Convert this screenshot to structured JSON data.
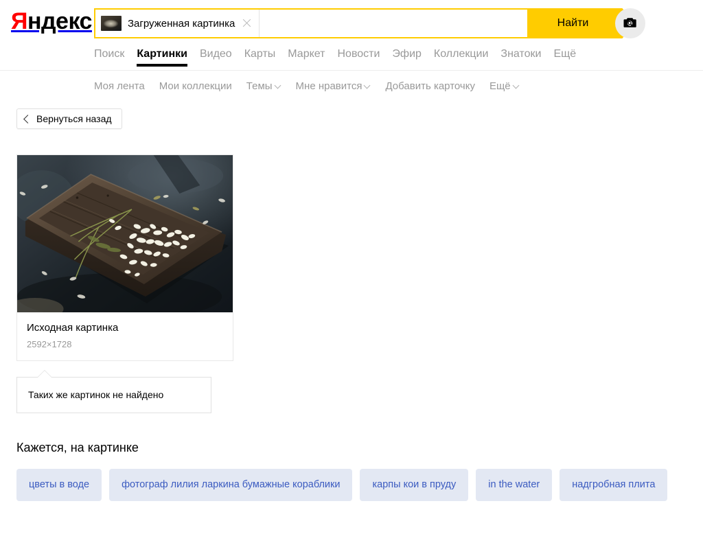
{
  "brand": {
    "logo_first_letter": "Я",
    "logo_rest": "ндекс"
  },
  "search": {
    "chip_label": "Загруженная картинка",
    "chip_thumb_icon": "uploaded-image-thumbnail",
    "chip_close_icon": "close-icon",
    "input_value": "",
    "input_placeholder": "",
    "submit_label": "Найти",
    "camera_icon": "camera-search-icon"
  },
  "nav": {
    "tabs": [
      {
        "label": "Поиск",
        "active": false
      },
      {
        "label": "Картинки",
        "active": true
      },
      {
        "label": "Видео",
        "active": false
      },
      {
        "label": "Карты",
        "active": false
      },
      {
        "label": "Маркет",
        "active": false
      },
      {
        "label": "Новости",
        "active": false
      },
      {
        "label": "Эфир",
        "active": false
      },
      {
        "label": "Коллекции",
        "active": false
      },
      {
        "label": "Знатоки",
        "active": false
      },
      {
        "label": "Ещё",
        "active": false
      }
    ]
  },
  "subnav": {
    "items": [
      {
        "label": "Моя лента",
        "caret": false
      },
      {
        "label": "Мои коллекции",
        "caret": false
      },
      {
        "label": "Темы",
        "caret": true
      },
      {
        "label": "Мне нравится",
        "caret": true
      },
      {
        "label": "Добавить карточку",
        "caret": false
      },
      {
        "label": "Ещё",
        "caret": true
      }
    ]
  },
  "back_button": {
    "label": "Вернуться назад",
    "icon": "chevron-left-icon"
  },
  "image_card": {
    "title": "Исходная картинка",
    "dimensions": "2592×1728",
    "photo_alt": "wooden-tray-floating-in-dark-water-with-white-petals"
  },
  "callout": {
    "text": "Таких же картинок не найдено"
  },
  "tags_section": {
    "heading": "Кажется, на картинке",
    "tags": [
      "цветы в воде",
      "фотограф лилия ларкина бумажные кораблики",
      "карпы кои в пруду",
      "in the water",
      "надгробная плита"
    ]
  },
  "colors": {
    "accent_yellow": "#ffcc00",
    "logo_red": "#ff0000",
    "tag_bg": "#e3e8f3",
    "tag_text": "#3b5bc0",
    "muted_text": "#999999"
  }
}
